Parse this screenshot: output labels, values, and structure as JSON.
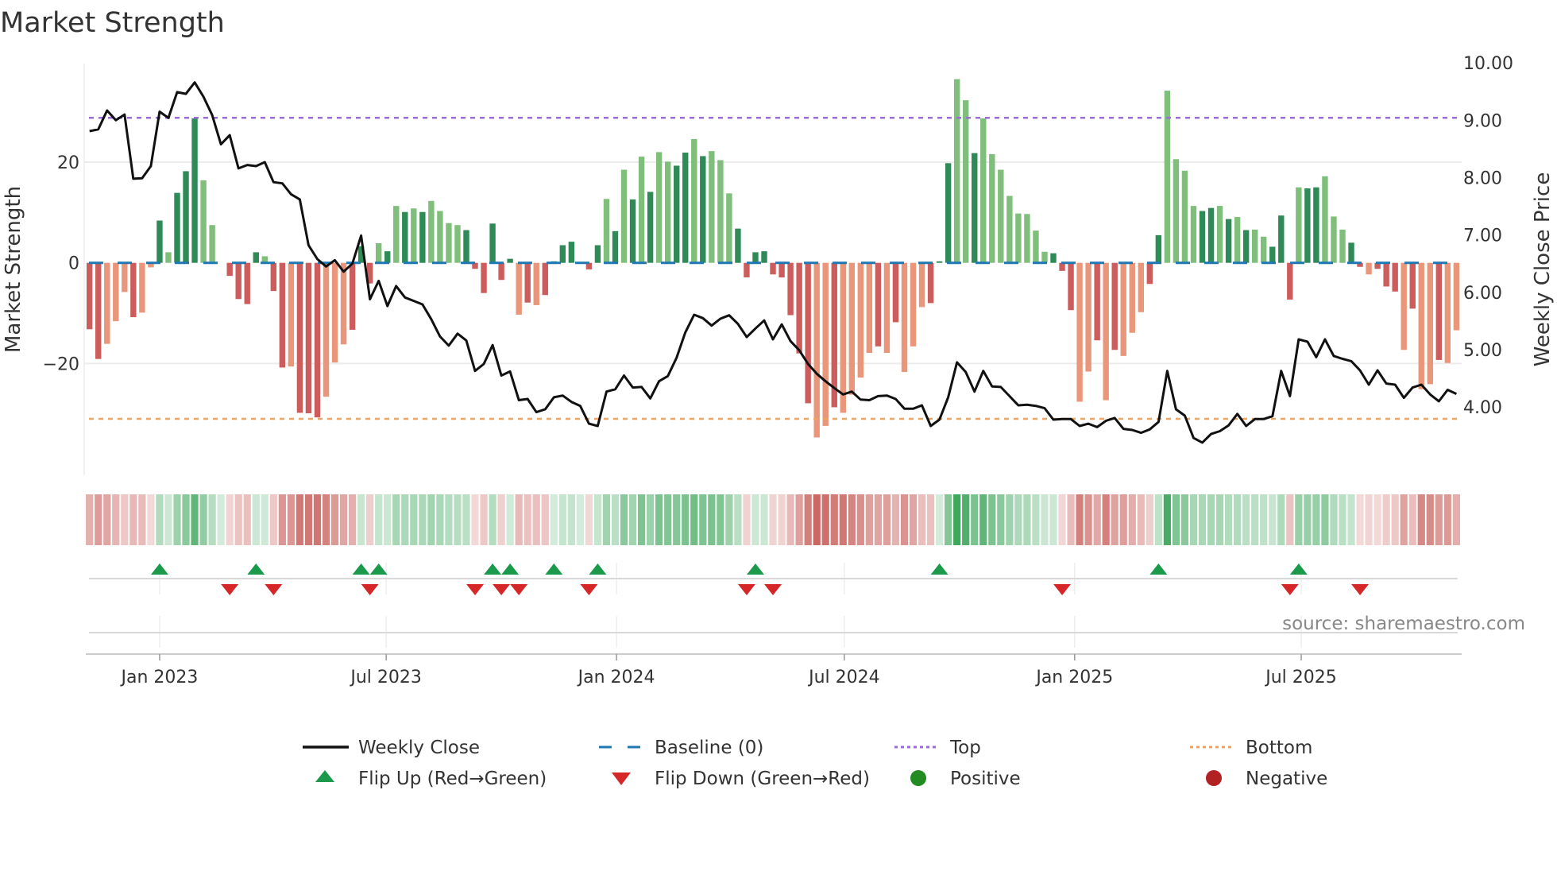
{
  "chart_data": {
    "type": "bar",
    "title": "Market Strength",
    "ylabel": "Market Strength",
    "y2label": "Weekly Close Price",
    "ylim": [
      -40,
      40
    ],
    "y2lim": [
      3.0,
      10.2
    ],
    "yticks": [
      {
        "value": 20,
        "label": "20"
      },
      {
        "value": 0,
        "label": "0"
      },
      {
        "value": -20,
        "label": "−20"
      }
    ],
    "y2ticks": [
      {
        "value": 10,
        "label": "10.00"
      },
      {
        "value": 9,
        "label": "9.00"
      },
      {
        "value": 8,
        "label": "8.00"
      },
      {
        "value": 7,
        "label": "7.00"
      },
      {
        "value": 6,
        "label": "6.00"
      },
      {
        "value": 5,
        "label": "5.00"
      },
      {
        "value": 4,
        "label": "4.00"
      }
    ],
    "x_start": "2022-11-06",
    "x_interval": "weekly",
    "x_ticks": [
      {
        "label": "Jan 2023",
        "date": "2023-01-01"
      },
      {
        "label": "Jul 2023",
        "date": "2023-07-01"
      },
      {
        "label": "Jan 2024",
        "date": "2024-01-01"
      },
      {
        "label": "Jul 2024",
        "date": "2024-07-01"
      },
      {
        "label": "Jan 2025",
        "date": "2025-01-01"
      },
      {
        "label": "Jul 2025",
        "date": "2025-07-01"
      }
    ],
    "top_level": 28.8,
    "bottom_level": -31.0,
    "baseline": 0,
    "strength": [
      -13.2,
      -19.1,
      -16.1,
      -11.6,
      -5.8,
      -10.8,
      -9.9,
      -0.9,
      8.4,
      2.1,
      13.9,
      18.2,
      28.7,
      16.4,
      7.5,
      0,
      -2.6,
      -7.2,
      -8.2,
      2.1,
      1.3,
      -5.6,
      -20.8,
      -20.6,
      -29.8,
      -29.9,
      -30.7,
      -26.6,
      -19.8,
      -16.2,
      -13.3,
      3.3,
      -4.1,
      3.9,
      2.3,
      11.3,
      10.1,
      10.8,
      10.1,
      12.3,
      10.3,
      7.9,
      7.5,
      6.5,
      -1.2,
      -6.0,
      7.8,
      -3.4,
      0.8,
      -10.3,
      -7.9,
      -8.4,
      -6.4,
      0.3,
      3.5,
      4.2,
      0,
      -1.3,
      3.5,
      12.7,
      6.3,
      18.5,
      12.6,
      21.1,
      14.1,
      22.0,
      20.1,
      19.3,
      21.9,
      24.6,
      21.2,
      22.2,
      20.4,
      13.8,
      6.8,
      -2.9,
      2.1,
      2.3,
      -2.3,
      -2.9,
      -10.4,
      -18.0,
      -27.9,
      -34.7,
      -32.4,
      -28.7,
      -29.8,
      -26.2,
      -22.8,
      -17.9,
      -16.6,
      -17.9,
      -11.8,
      -21.7,
      -16.6,
      -8.8,
      -8.0,
      0.3,
      19.8,
      36.5,
      32.3,
      21.8,
      28.7,
      21.6,
      18.5,
      13.3,
      9.8,
      9.7,
      6.4,
      2.2,
      1.9,
      -1.6,
      -9.4,
      -27.6,
      -21.6,
      -15.4,
      -27.3,
      -17.3,
      -18.5,
      -13.9,
      -9.8,
      -4.2,
      5.5,
      34.2,
      20.6,
      18.3,
      11.3,
      10.3,
      10.9,
      11.3,
      8.7,
      9.1,
      6.5,
      6.6,
      5.2,
      3.2,
      9.4,
      -7.3,
      15.0,
      14.8,
      15.0,
      17.2,
      9.2,
      6.6,
      4.0,
      -0.8,
      -2.3,
      -1.2,
      -4.7,
      -5.7,
      -17.3,
      -9.1,
      -25.1,
      -24.1,
      -19.3,
      -19.9,
      -13.4
    ],
    "shade": "ddllldlldldddllddddd lddldddllldddldldldlllldddddd ldlddddddd ldldldlldd ldlllddddd ddddlldlll ldldlllddd lldlllllll ldddlldldl llddlllldd ldldlldddl ddlllddldd dldlldl",
    "weekly_close": [
      8.81,
      8.84,
      9.17,
      9.0,
      9.1,
      7.98,
      7.99,
      8.2,
      9.15,
      9.04,
      9.49,
      9.46,
      9.66,
      9.41,
      9.09,
      8.58,
      8.74,
      8.16,
      8.22,
      8.2,
      8.27,
      7.92,
      7.9,
      7.71,
      7.62,
      6.82,
      6.58,
      6.45,
      6.56,
      6.36,
      6.5,
      6.99,
      5.88,
      6.2,
      5.76,
      6.11,
      5.91,
      5.85,
      5.79,
      5.53,
      5.23,
      5.07,
      5.28,
      5.16,
      4.63,
      4.75,
      5.08,
      4.55,
      4.62,
      4.12,
      4.14,
      3.91,
      3.96,
      4.17,
      4.2,
      4.09,
      4.02,
      3.71,
      3.67,
      4.27,
      4.31,
      4.55,
      4.34,
      4.35,
      4.15,
      4.45,
      4.54,
      4.86,
      5.3,
      5.61,
      5.55,
      5.42,
      5.54,
      5.6,
      5.45,
      5.22,
      5.37,
      5.51,
      5.18,
      5.44,
      5.15,
      4.99,
      4.75,
      4.58,
      4.45,
      4.33,
      4.22,
      4.27,
      4.13,
      4.12,
      4.19,
      4.2,
      4.14,
      3.97,
      3.97,
      4.03,
      3.67,
      3.78,
      4.17,
      4.78,
      4.61,
      4.27,
      4.63,
      4.36,
      4.35,
      4.19,
      4.03,
      4.04,
      4.02,
      3.98,
      3.78,
      3.79,
      3.79,
      3.67,
      3.71,
      3.65,
      3.76,
      3.81,
      3.62,
      3.6,
      3.55,
      3.61,
      3.74,
      4.63,
      3.96,
      3.85,
      3.46,
      3.38,
      3.53,
      3.58,
      3.68,
      3.88,
      3.67,
      3.79,
      3.79,
      3.84,
      4.63,
      4.19,
      5.18,
      5.14,
      4.87,
      5.18,
      4.89,
      4.84,
      4.8,
      4.64,
      4.39,
      4.64,
      4.41,
      4.39,
      4.16,
      4.34,
      4.39,
      4.22,
      4.1,
      4.3,
      4.23
    ],
    "flip_up_weeks": [
      9,
      20,
      32,
      34,
      47,
      49,
      54,
      59,
      77,
      98,
      123,
      139
    ],
    "flip_down_weeks": [
      17,
      22,
      33,
      45,
      48,
      50,
      58,
      76,
      79,
      112,
      138,
      146
    ],
    "legend": [
      {
        "key": "weekly_close",
        "label": "Weekly Close",
        "kind": "line"
      },
      {
        "key": "baseline",
        "label": "Baseline (0)",
        "kind": "dash"
      },
      {
        "key": "top",
        "label": "Top",
        "kind": "dot"
      },
      {
        "key": "bottom",
        "label": "Bottom",
        "kind": "dot"
      },
      {
        "key": "flip_up",
        "label": "Flip Up (Red→Green)",
        "kind": "tri-up"
      },
      {
        "key": "flip_down",
        "label": "Flip Down (Green→Red)",
        "kind": "tri-down"
      },
      {
        "key": "positive",
        "label": "Positive",
        "kind": "circle"
      },
      {
        "key": "negative",
        "label": "Negative",
        "kind": "circle"
      }
    ],
    "legend_placement": "bottom-center",
    "source": "source: sharemaestro.com",
    "colors": {
      "pos_strong": "#2e8b57",
      "pos_weak": "#7fbf7b",
      "neg_strong": "#cd5c5c",
      "neg_weak": "#e9967a",
      "line": "#111111",
      "baseline": "#1f77b4",
      "top": "#9b6ddb",
      "bottom": "#f0a35e",
      "flip_up": "#1a9a4a",
      "flip_down": "#d62728",
      "positive": "#228b22",
      "negative": "#b22222",
      "grid": "#ebebeb"
    }
  }
}
